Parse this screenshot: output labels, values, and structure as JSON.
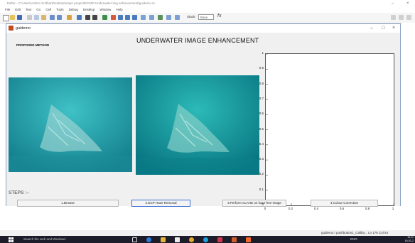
{
  "editor": {
    "title": "Editor - C:\\Users\\Ashmi Sridhar\\Desktop\\major project\\EC500 Underwater img enhancement\\guidemo.m",
    "menu": [
      "File",
      "Edit",
      "Text",
      "Go",
      "Cell",
      "Tools",
      "Debug",
      "Desktop",
      "Window",
      "Help"
    ],
    "stack_label": "Stack:",
    "stack_value": "Base",
    "fx_symbol": "fx",
    "minimize": "–",
    "close": "×"
  },
  "gui": {
    "window_title": "guidemo",
    "minimize": "–",
    "maximize": "□",
    "close": "×",
    "label_method": "PROPOSED METHOD",
    "main_title": "UNDERWATER IMAGE ENHANCEMENT",
    "steps_label": "STEPS :--",
    "buttons": {
      "browse": "1.Browse",
      "dcp": "2.DCP Haze Removal",
      "clahe": "3.Perform CLAHE on haze free image",
      "colour": "4.Colour Correction"
    }
  },
  "chart_data": {
    "type": "line",
    "x": [],
    "series": [],
    "xlim": [
      0,
      1
    ],
    "ylim": [
      0,
      1
    ],
    "xticks": [
      "0",
      "0.2",
      "0.4",
      "0.6",
      "0.8",
      "1"
    ],
    "yticks": [
      "0",
      "0.1",
      "0.2",
      "0.3",
      "0.4",
      "0.5",
      "0.6",
      "0.7",
      "0.8",
      "0.9",
      "1"
    ],
    "grid": false
  },
  "status": {
    "text": "guidemo / pushbutton1_Callba...   Ln  176   Col  54"
  },
  "taskbar": {
    "search": "Search the web and Windows",
    "tray": "ENG",
    "time": "16:11",
    "date": "16-03-2"
  },
  "colors": {
    "accent": "#3a6fd8",
    "water_original": "#1e9aa8",
    "water_dehazed": "#0f9aa3"
  }
}
